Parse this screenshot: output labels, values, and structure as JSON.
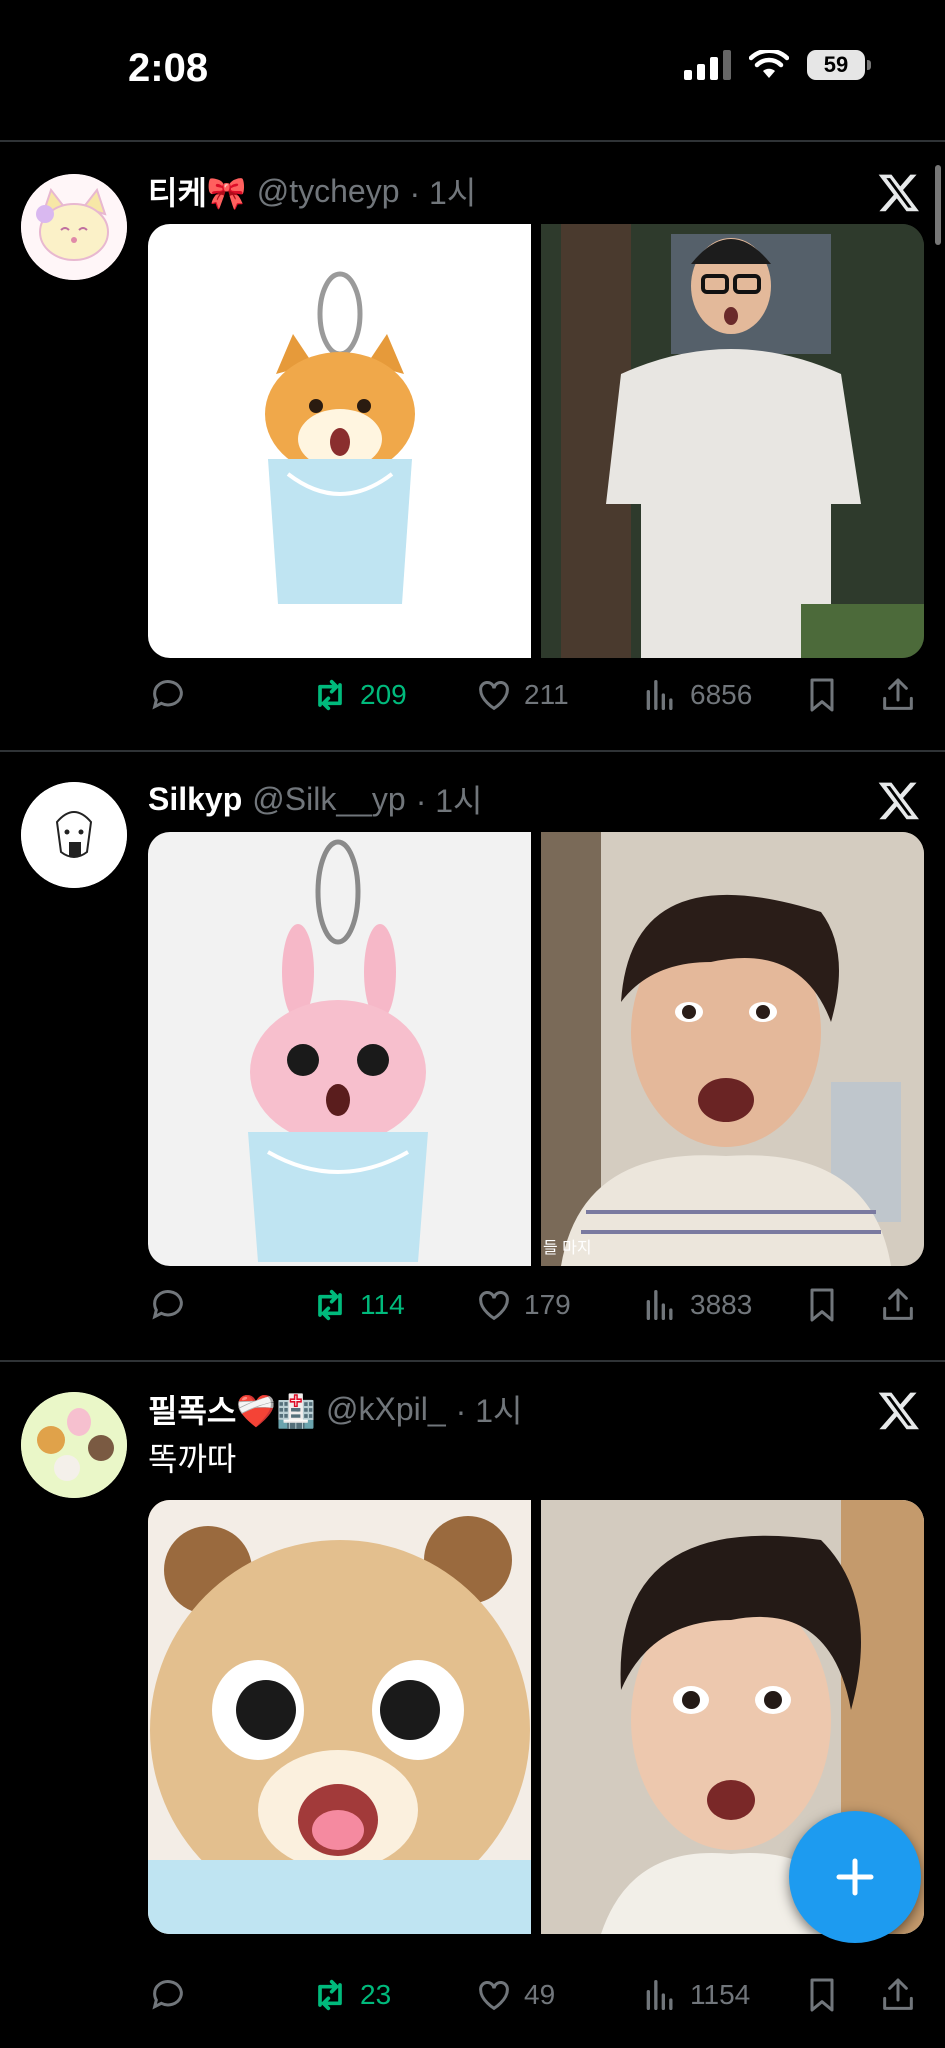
{
  "status": {
    "time": "2:08",
    "battery": "59"
  },
  "tweets": [
    {
      "name": "티케",
      "name_emoji": "🎀",
      "handle": "@tycheyp",
      "time": "· 1시",
      "text": "",
      "replies": "",
      "retweets": "209",
      "likes": "211",
      "views": "6856"
    },
    {
      "name": "Silkyp",
      "name_emoji": "",
      "handle": "@Silk__yp",
      "time": "· 1시",
      "text": "",
      "replies": "",
      "retweets": "114",
      "likes": "179",
      "views": "3883"
    },
    {
      "name": "필폭스",
      "name_emoji": "❤️‍🩹🏥",
      "handle": "@kXpil_",
      "time": "· 1시",
      "text": "똑까따",
      "replies": "",
      "retweets": "23",
      "likes": "49",
      "views": "1154"
    }
  ],
  "image_captions": {
    "video_overlay": "들 마지"
  },
  "icons": {
    "reply": "reply-icon",
    "retweet": "retweet-icon",
    "like": "heart-icon",
    "views": "views-icon",
    "bookmark": "bookmark-icon",
    "share": "share-icon",
    "compose": "compose-plus-icon",
    "x_logo": "x-logo-icon"
  },
  "colors": {
    "retweet_active": "#00ba7c",
    "fab": "#1d9bf0",
    "muted": "#71767b"
  }
}
